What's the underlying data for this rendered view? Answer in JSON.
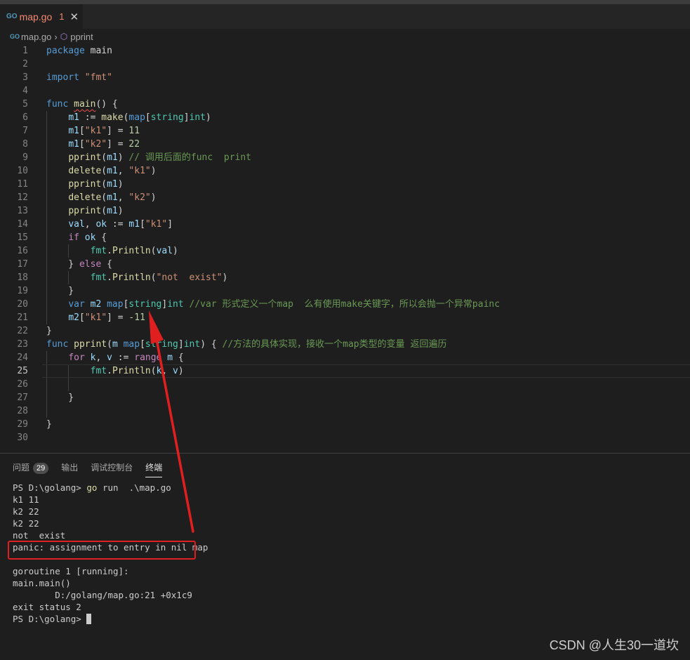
{
  "tab": {
    "filename": "map.go",
    "problem_count": "1",
    "lang_icon": "GO",
    "close_glyph": "✕"
  },
  "breadcrumb": {
    "file": "map.go",
    "symbol": "pprint",
    "lang_icon": "GO"
  },
  "panel": {
    "tabs": [
      {
        "label": "问题",
        "badge": "29"
      },
      {
        "label": "输出"
      },
      {
        "label": "调试控制台"
      },
      {
        "label": "终端"
      }
    ],
    "active_tab": "终端"
  },
  "terminal": {
    "prompt": "PS D:\\golang> ",
    "command_go": "go",
    "command_rest": " run  .\\map.go",
    "lines": [
      "k1 11",
      "k2 22",
      "k2 22",
      "not  exist",
      "panic: assignment to entry in nil map",
      "",
      "goroutine 1 [running]:",
      "main.main()",
      "        D:/golang/map.go:21 +0x1c9",
      "exit status 2"
    ],
    "final_prompt": "PS D:\\golang> "
  },
  "watermark": "CSDN @人生30一道坎",
  "colors": {
    "annotation_red": "#e02020",
    "error_text": "#f48771"
  }
}
